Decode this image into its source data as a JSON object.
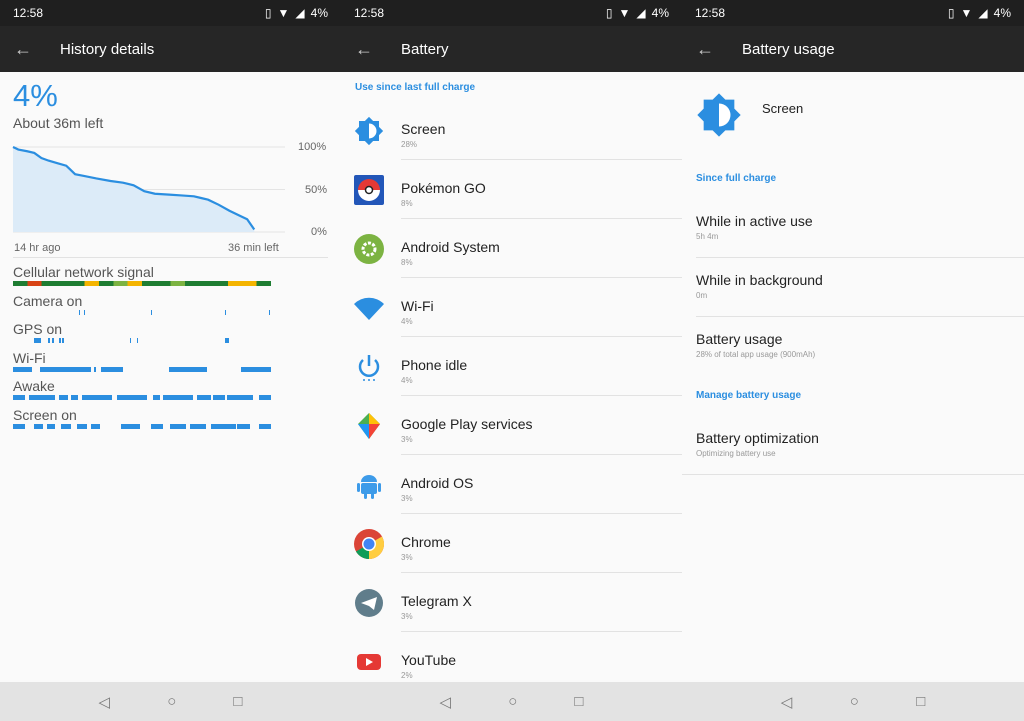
{
  "status_bar": {
    "time": "12:58",
    "battery": "4%"
  },
  "panel1": {
    "title": "History details",
    "battery_percent": "4%",
    "time_left": "About 36m left",
    "chart_data": {
      "type": "area",
      "x_start_label": "14 hr ago",
      "x_end_label": "36 min left",
      "y_ticks": [
        "100%",
        "50%",
        "0%"
      ],
      "ylim": [
        0,
        100
      ],
      "x_hours": [
        0,
        0.3,
        0.8,
        1.2,
        1.6,
        2.0,
        2.5,
        3.0,
        3.2,
        3.5,
        4.0,
        4.7,
        5.5,
        6.2,
        6.8,
        7.4,
        8.0,
        8.8,
        9.5,
        10.2,
        10.6,
        11.0,
        11.6,
        12.2,
        12.8,
        13.2,
        13.6
      ],
      "battery": [
        100,
        97,
        95,
        93,
        87,
        84,
        81,
        78,
        74,
        68,
        66,
        63,
        60,
        58,
        55,
        48,
        45,
        44,
        43,
        42,
        40,
        38,
        32,
        25,
        19,
        15,
        3
      ],
      "x_total_hours": 14.6
    },
    "activity": [
      {
        "label": "Cellular network signal",
        "type": "signal"
      },
      {
        "label": "Camera on",
        "segments": [
          [
            3.75,
            3.8
          ],
          [
            4.0,
            4.05
          ],
          [
            7.8,
            7.85
          ],
          [
            12.0,
            12.05
          ],
          [
            14.5,
            14.55
          ]
        ]
      },
      {
        "label": "GPS on",
        "segments": [
          [
            1.2,
            1.6
          ],
          [
            2.0,
            2.1
          ],
          [
            2.2,
            2.3
          ],
          [
            2.6,
            2.7
          ],
          [
            2.8,
            2.9
          ],
          [
            6.6,
            6.7
          ],
          [
            7.0,
            7.1
          ],
          [
            12.0,
            12.2
          ]
        ]
      },
      {
        "label": "Wi-Fi",
        "segments": [
          [
            0,
            1.1
          ],
          [
            1.5,
            4.4
          ],
          [
            4.6,
            4.7
          ],
          [
            5.0,
            6.2
          ],
          [
            8.8,
            11.0
          ],
          [
            12.9,
            14.6
          ]
        ]
      },
      {
        "label": "Awake",
        "segments": [
          [
            0,
            0.7
          ],
          [
            0.9,
            2.4
          ],
          [
            2.6,
            3.1
          ],
          [
            3.3,
            3.7
          ],
          [
            3.9,
            5.6
          ],
          [
            5.9,
            7.6
          ],
          [
            7.9,
            8.3
          ],
          [
            8.5,
            10.2
          ],
          [
            10.4,
            11.2
          ],
          [
            11.3,
            12.0
          ],
          [
            12.1,
            13.6
          ],
          [
            13.9,
            14.6
          ]
        ]
      },
      {
        "label": "Screen on",
        "segments": [
          [
            0,
            0.7
          ],
          [
            1.2,
            1.7
          ],
          [
            1.9,
            2.4
          ],
          [
            2.7,
            3.3
          ],
          [
            3.6,
            4.2
          ],
          [
            4.4,
            4.9
          ],
          [
            6.1,
            7.2
          ],
          [
            7.8,
            8.5
          ],
          [
            8.9,
            9.8
          ],
          [
            10.0,
            10.9
          ],
          [
            11.2,
            12.6
          ],
          [
            12.7,
            13.4
          ],
          [
            13.9,
            14.6
          ]
        ]
      }
    ]
  },
  "panel2": {
    "title": "Battery",
    "section": "Use since last full charge",
    "items": [
      {
        "name": "Screen",
        "usage": "28%",
        "icon": "brightness-icon"
      },
      {
        "name": "Pokémon GO",
        "usage": "8%",
        "icon": "pokemon-go-icon"
      },
      {
        "name": "Android System",
        "usage": "8%",
        "icon": "android-system-icon"
      },
      {
        "name": "Wi-Fi",
        "usage": "4%",
        "icon": "wifi-icon"
      },
      {
        "name": "Phone idle",
        "usage": "4%",
        "icon": "power-icon"
      },
      {
        "name": "Google Play services",
        "usage": "3%",
        "icon": "google-play-services-icon"
      },
      {
        "name": "Android OS",
        "usage": "3%",
        "icon": "android-icon"
      },
      {
        "name": "Chrome",
        "usage": "3%",
        "icon": "chrome-icon"
      },
      {
        "name": "Telegram X",
        "usage": "3%",
        "icon": "telegram-icon"
      },
      {
        "name": "YouTube",
        "usage": "2%",
        "icon": "youtube-icon"
      }
    ]
  },
  "panel3": {
    "title": "Battery usage",
    "app_name": "Screen",
    "section1": "Since full charge",
    "rows": [
      {
        "title": "While in active use",
        "sub": "5h 4m"
      },
      {
        "title": "While in background",
        "sub": "0m"
      },
      {
        "title": "Battery usage",
        "sub": "28% of total app usage (900mAh)"
      }
    ],
    "section2": "Manage battery usage",
    "optimization": {
      "title": "Battery optimization",
      "sub": "Optimizing battery use"
    }
  },
  "colors": {
    "accent": "#2b8ee0",
    "signal_good": "#1e7d32",
    "signal_mid": "#7cb342",
    "signal_poor": "#f4b400",
    "signal_bad": "#d84315"
  }
}
